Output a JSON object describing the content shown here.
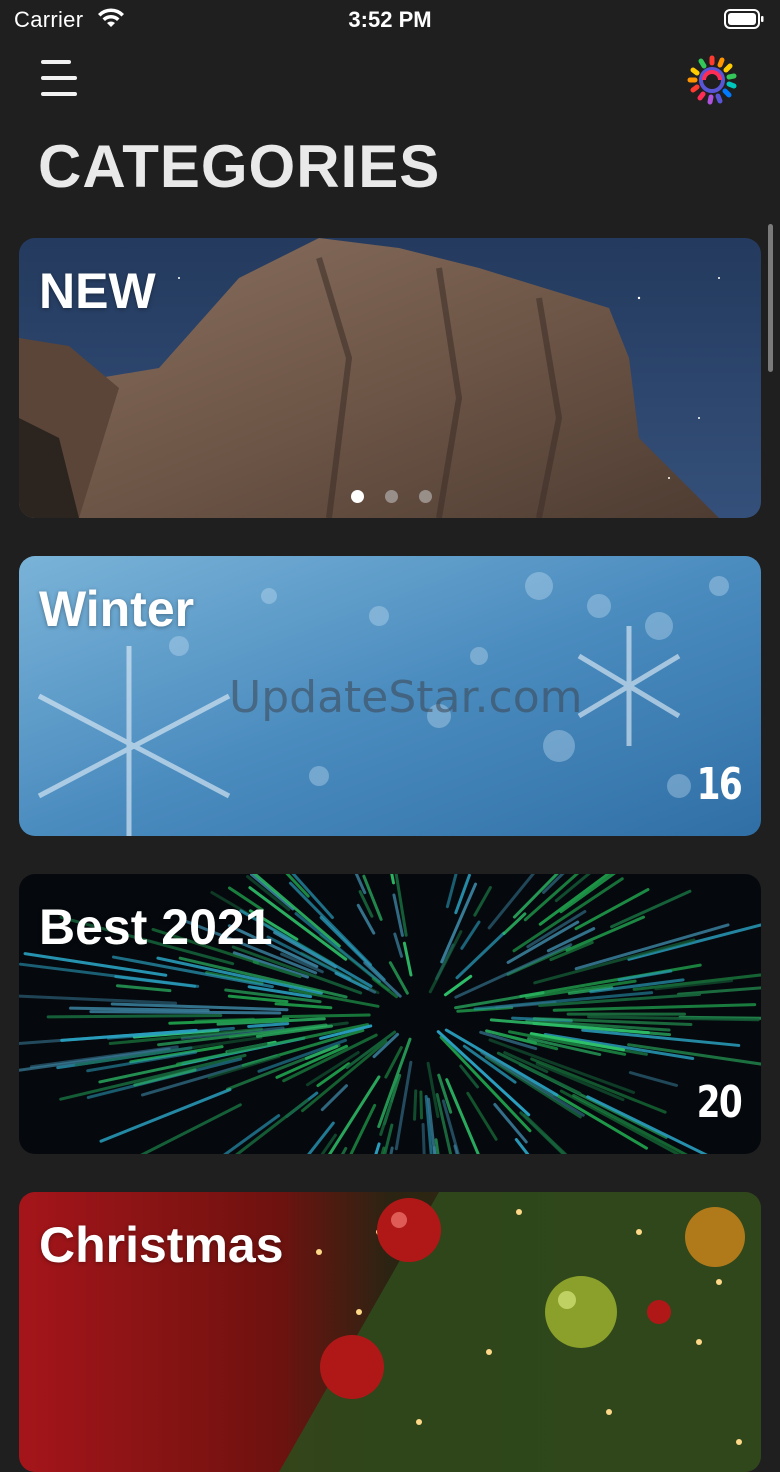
{
  "status_bar": {
    "carrier": "Carrier",
    "time": "3:52 PM"
  },
  "header": {
    "menu_icon": "hamburger-menu-icon",
    "logo_icon": "rainbow-aperture-logo",
    "title": "CATEGORIES"
  },
  "carousel": {
    "active_index": 0,
    "count": 3
  },
  "categories": [
    {
      "title": "NEW",
      "count": ""
    },
    {
      "title": "Winter",
      "count": "16",
      "watermark": "UpdateStar.com"
    },
    {
      "title": "Best 2021",
      "count": "20"
    },
    {
      "title": "Christmas",
      "count": ""
    }
  ],
  "colors": {
    "background": "#1f1f1f",
    "title": "#e9e9e9"
  }
}
